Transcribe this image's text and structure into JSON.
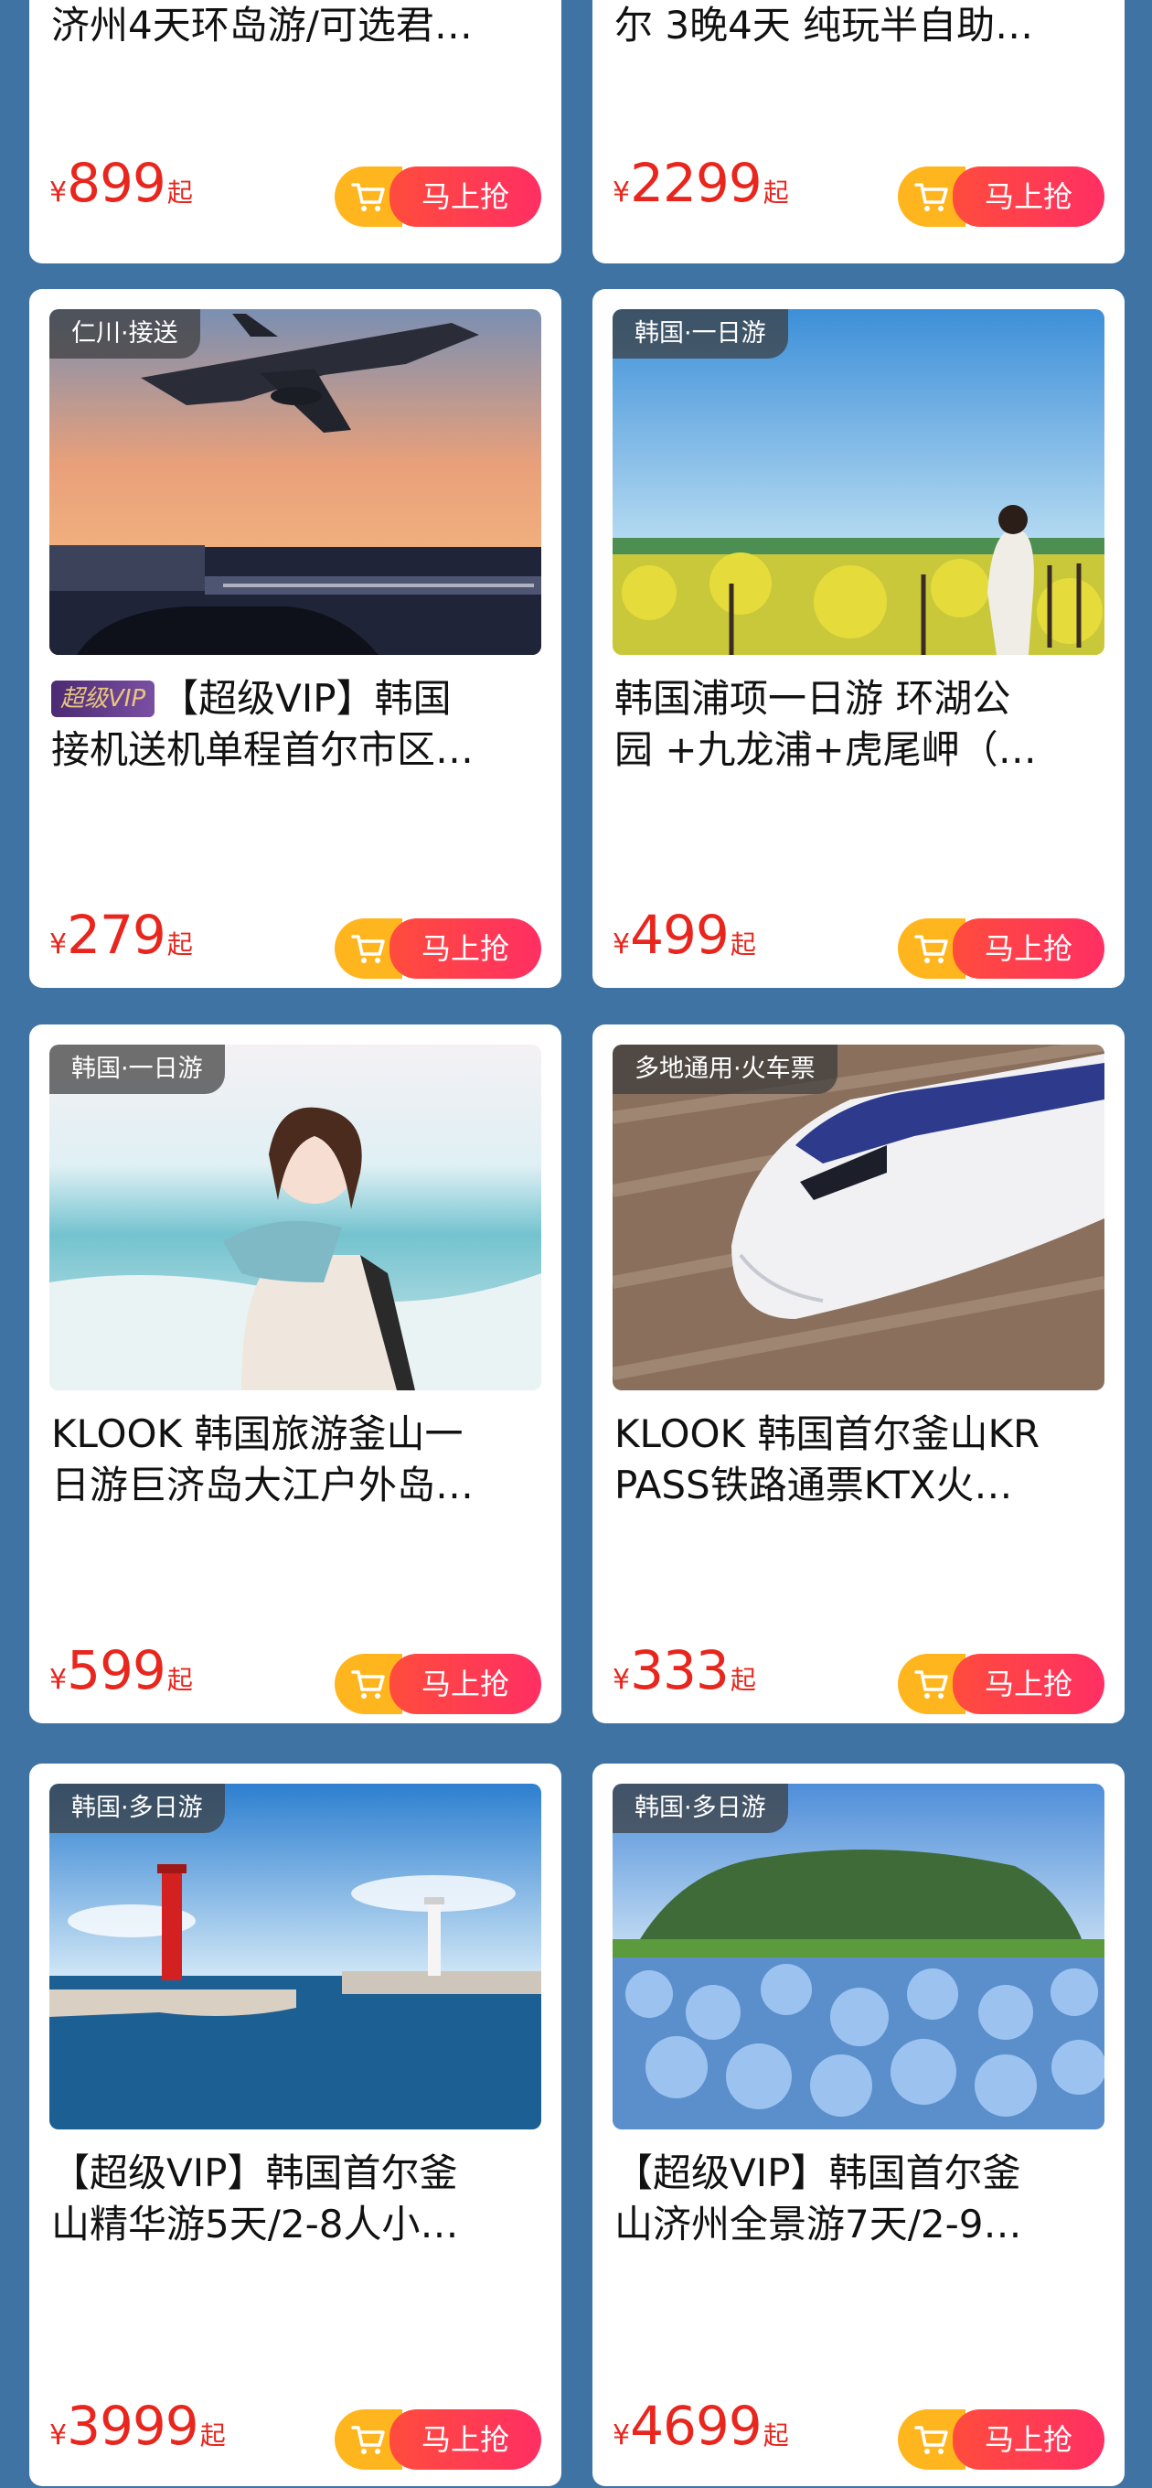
{
  "top_cards": [
    {
      "title": "济州4天环岛游/可选君…",
      "price_yen": "¥",
      "price": "899",
      "price_suffix": "起",
      "buy_label": "马上抢"
    },
    {
      "title": "尔  3晚4天  纯玩半自助…",
      "price_yen": "¥",
      "price": "2299",
      "price_suffix": "起",
      "buy_label": "马上抢"
    }
  ],
  "cards": [
    {
      "tag": "仁川·接送",
      "vip_badge": "超级VIP",
      "title_line1": "【超级VIP】韩国",
      "title_line2": "接机送机单程首尔市区…",
      "price_yen": "¥",
      "price": "279",
      "price_suffix": "起",
      "buy_label": "马上抢",
      "image": "airplane-at-sunset-airport"
    },
    {
      "tag": "韩国·一日游",
      "title_line1": "韩国浦项一日游 环湖公",
      "title_line2": "园 +九龙浦+虎尾岬（…",
      "price_yen": "¥",
      "price": "499",
      "price_suffix": "起",
      "buy_label": "马上抢",
      "image": "canola-flower-field-girl"
    },
    {
      "tag": "韩国·一日游",
      "title_line1": "KLOOK 韩国旅游釜山一",
      "title_line2": "日游巨济岛大江户外岛…",
      "price_yen": "¥",
      "price": "599",
      "price_suffix": "起",
      "buy_label": "马上抢",
      "image": "girl-at-seaside"
    },
    {
      "tag": "多地通用·火车票",
      "title_line1": "KLOOK 韩国首尔釜山KR",
      "title_line2": "PASS铁路通票KTX火…",
      "price_yen": "¥",
      "price": "333",
      "price_suffix": "起",
      "buy_label": "马上抢",
      "image": "ktx-bullet-train"
    },
    {
      "tag": "韩国·多日游",
      "title_line1": "【超级VIP】韩国首尔釜",
      "title_line2": "山精华游5天/2-8人小…",
      "price_yen": "¥",
      "price": "3999",
      "price_suffix": "起",
      "buy_label": "马上抢",
      "image": "red-lighthouse-harbor"
    },
    {
      "tag": "韩国·多日游",
      "title_line1": "【超级VIP】韩国首尔釜",
      "title_line2": "山济州全景游7天/2-9…",
      "price_yen": "¥",
      "price": "4699",
      "price_suffix": "起",
      "buy_label": "马上抢",
      "image": "hydrangea-and-sunrise-peak"
    }
  ],
  "colors": {
    "background": "#3f73a3",
    "price": "#e8261d",
    "cart_bg": "#ffb61e",
    "buy_gradient_start": "#ff4c3d",
    "buy_gradient_end": "#ff2f63"
  }
}
